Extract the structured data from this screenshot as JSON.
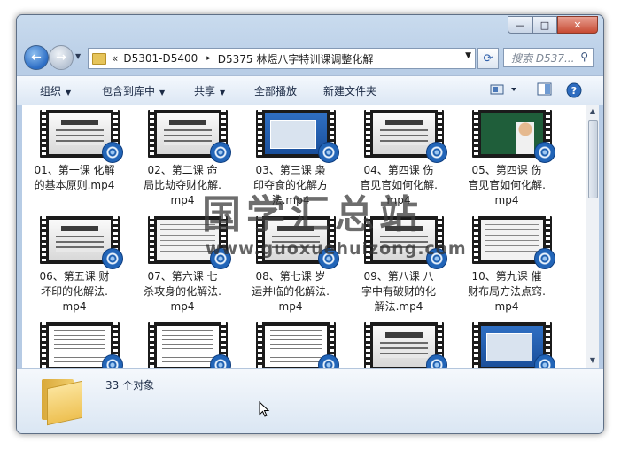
{
  "window": {
    "buttons": {
      "minimize": "—",
      "maximize": "□",
      "close": "✕"
    }
  },
  "nav": {
    "back_icon": "←",
    "forward_icon": "→",
    "address": {
      "overflow": "«",
      "crumbs": [
        "D5301-D5400",
        "D5375 林煜八字特训课调整化解"
      ],
      "separator": "▸"
    },
    "search_placeholder": "搜索 D537...",
    "refresh_icon": "⟳"
  },
  "toolbar": {
    "organize": "组织",
    "include_in_library": "包含到库中",
    "share": "共享",
    "play_all": "全部播放",
    "new_folder": "新建文件夹"
  },
  "files": [
    {
      "name": "01、第一课 化解的基本原则.mp4",
      "thumb": "ppt"
    },
    {
      "name": "02、第二课 命局比劫夺财化解.mp4",
      "thumb": "ppt"
    },
    {
      "name": "03、第三课 枭印夺食的化解方法.mp4",
      "thumb": "desk"
    },
    {
      "name": "04、第四课 伤官见官如何化解.mp4",
      "thumb": "ppt"
    },
    {
      "name": "05、第四课 伤官见官如何化解.mp4",
      "thumb": "teacher"
    },
    {
      "name": "06、第五课 财坏印的化解法.mp4",
      "thumb": "ppt"
    },
    {
      "name": "07、第六课 七杀攻身的化解法.mp4",
      "thumb": "doc2"
    },
    {
      "name": "08、第七课 岁运并临的化解法.mp4",
      "thumb": "ppt"
    },
    {
      "name": "09、第八课 八字中有破财的化解法.mp4",
      "thumb": "ppt"
    },
    {
      "name": "10、第九课 催财布局方法点窍.mp4",
      "thumb": "doc2"
    },
    {
      "name": "",
      "thumb": "doc"
    },
    {
      "name": "",
      "thumb": "doc"
    },
    {
      "name": "",
      "thumb": "doc"
    },
    {
      "name": "",
      "thumb": "ppt"
    },
    {
      "name": "",
      "thumb": "desk"
    }
  ],
  "labels": [
    [
      "01、第一课 化解",
      "的基本原则.mp4"
    ],
    [
      "02、第二课  命",
      "局比劫夺财化解.",
      "mp4"
    ],
    [
      "03、第三课  枭",
      "印夺食的化解方",
      "法.mp4"
    ],
    [
      "04、第四课  伤",
      "官见官如何化解.",
      "mp4"
    ],
    [
      "05、第四课  伤",
      "官见官如何化解.",
      "mp4"
    ],
    [
      "06、第五课  财",
      "坏印的化解法.",
      "mp4"
    ],
    [
      "07、第六课  七",
      "杀攻身的化解法.",
      "mp4"
    ],
    [
      "08、第七课  岁",
      "运并临的化解法.",
      "mp4"
    ],
    [
      "09、第八课  八",
      "字中有破财的化",
      "解法.mp4"
    ],
    [
      "10、第九课  催",
      "财布局方法点窍.",
      "mp4"
    ]
  ],
  "details": {
    "count": "33 个对象"
  },
  "watermark": {
    "title": "国学汇总站",
    "url": "www.guoxuehuizong.com"
  }
}
